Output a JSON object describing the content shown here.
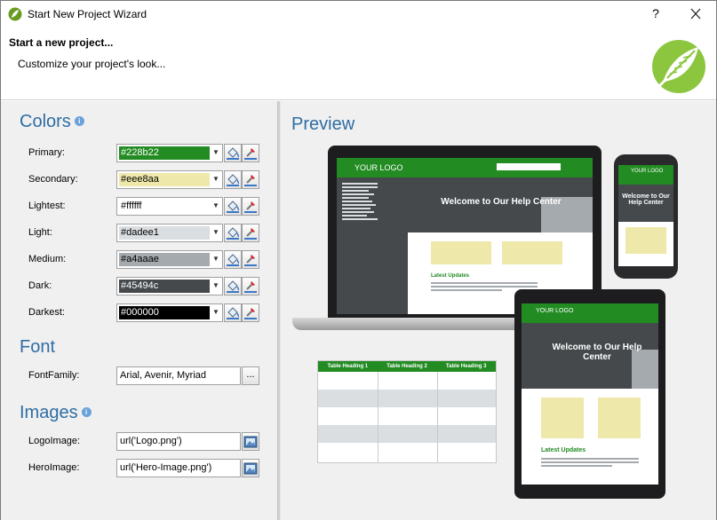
{
  "window": {
    "title": "Start New Project Wizard",
    "help_label": "?"
  },
  "header": {
    "title": "Start a new project...",
    "subtitle": "Customize your project's look..."
  },
  "colors_section": {
    "title": "Colors",
    "info_glyph": "i",
    "rows": [
      {
        "label": "Primary:",
        "value": "#228b22",
        "swatch": "#228b22",
        "text_color": "#ffffff"
      },
      {
        "label": "Secondary:",
        "value": "#eee8aa",
        "swatch": "#eee8aa",
        "text_color": "#000000"
      },
      {
        "label": "Lightest:",
        "value": "#ffffff",
        "swatch": "#ffffff",
        "text_color": "#000000"
      },
      {
        "label": "Light:",
        "value": "#dadee1",
        "swatch": "#dadee1",
        "text_color": "#000000"
      },
      {
        "label": "Medium:",
        "value": "#a4aaae",
        "swatch": "#a4aaae",
        "text_color": "#000000"
      },
      {
        "label": "Dark:",
        "value": "#45494c",
        "swatch": "#45494c",
        "text_color": "#ffffff"
      },
      {
        "label": "Darkest:",
        "value": "#000000",
        "swatch": "#000000",
        "text_color": "#ffffff"
      }
    ]
  },
  "font_section": {
    "title": "Font",
    "font_family_label": "FontFamily:",
    "font_family_value": "Arial, Avenir, Myriad",
    "browse_label": "..."
  },
  "images_section": {
    "title": "Images",
    "info_glyph": "i",
    "logo_label": "LogoImage:",
    "logo_value": "url('Logo.png')",
    "hero_label": "HeroImage:",
    "hero_value": "url('Hero-Image.png')"
  },
  "preview": {
    "title": "Preview",
    "logo_text": "YOUR LOGO",
    "hero_text": "Welcome to Our Help Center",
    "latest_updates": "Latest Updates",
    "table_headings": [
      "Table Heading 1",
      "Table Heading 2",
      "Table Heading 3"
    ]
  },
  "icons": {
    "app": "leaf-app-icon",
    "close": "close-icon",
    "brand": "feather-leaf-logo",
    "fill": "paint-bucket-icon",
    "picker": "eyedropper-icon",
    "image": "image-picker-icon"
  }
}
